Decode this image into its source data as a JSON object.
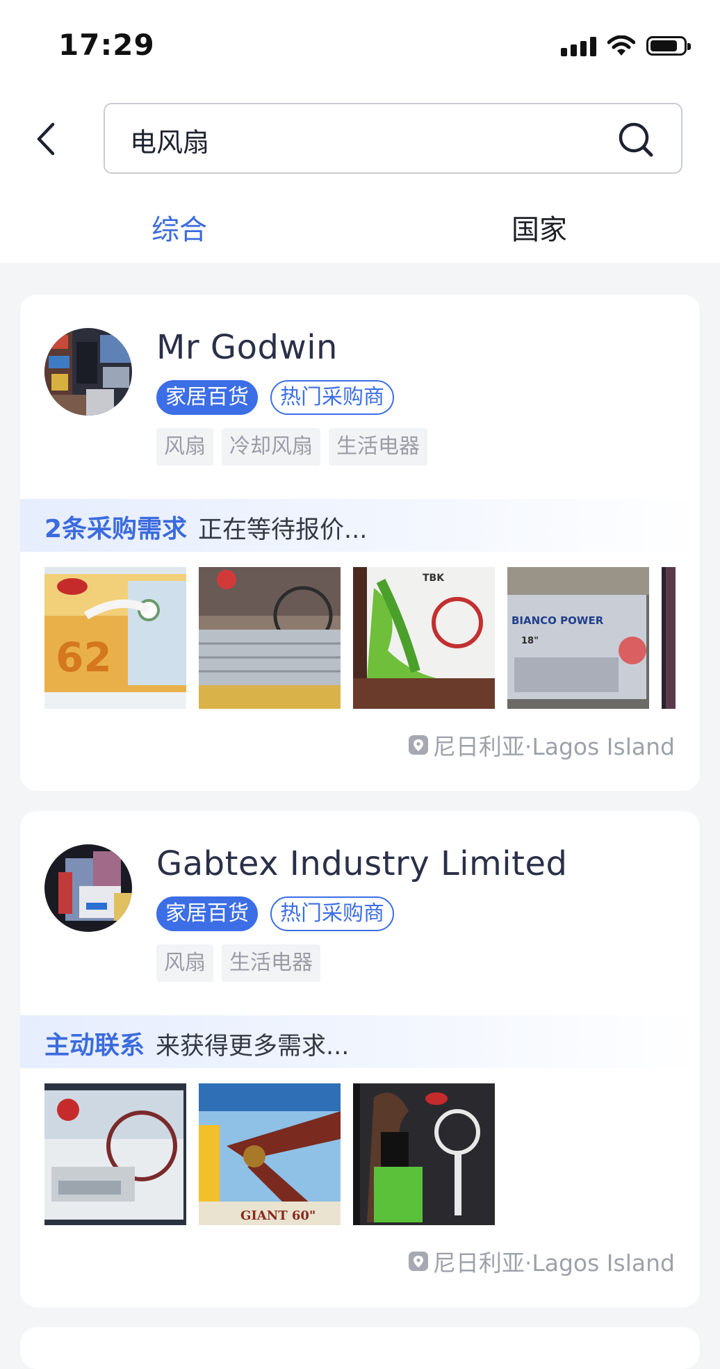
{
  "status_bar": {
    "time": "17:29"
  },
  "search": {
    "query": "电风扇"
  },
  "tabs": [
    {
      "label": "综合",
      "active": true
    },
    {
      "label": "国家",
      "active": false
    }
  ],
  "colors": {
    "accent": "#3c6ee6",
    "tag_bg": "#f2f3f5",
    "page_bg": "#f4f5f7"
  },
  "cards": [
    {
      "name": "Mr Godwin",
      "badges": [
        "家居百货",
        "热门采购商"
      ],
      "tags": [
        "风扇",
        "冷却风扇",
        "生活电器"
      ],
      "demand_highlight": "2条采购需求",
      "demand_text": "正在等待报价...",
      "thumbnails": [
        "ox-fan-box-62",
        "wall-fan-box",
        "tbk-fan-box",
        "bianco-power-fan-box",
        "partial-thumb"
      ],
      "location": "尼日利亚·Lagos Island"
    },
    {
      "name": "Gabtex Industry Limited",
      "badges": [
        "家居百货",
        "热门采购商"
      ],
      "tags": [
        "风扇",
        "生活电器"
      ],
      "demand_highlight": "主动联系",
      "demand_text": "来获得更多需求...",
      "thumbnails": [
        "wall-fan-box-18",
        "ceiling-fan-box",
        "ox-standing-fan-box"
      ],
      "location": "尼日利亚·Lagos Island"
    }
  ]
}
